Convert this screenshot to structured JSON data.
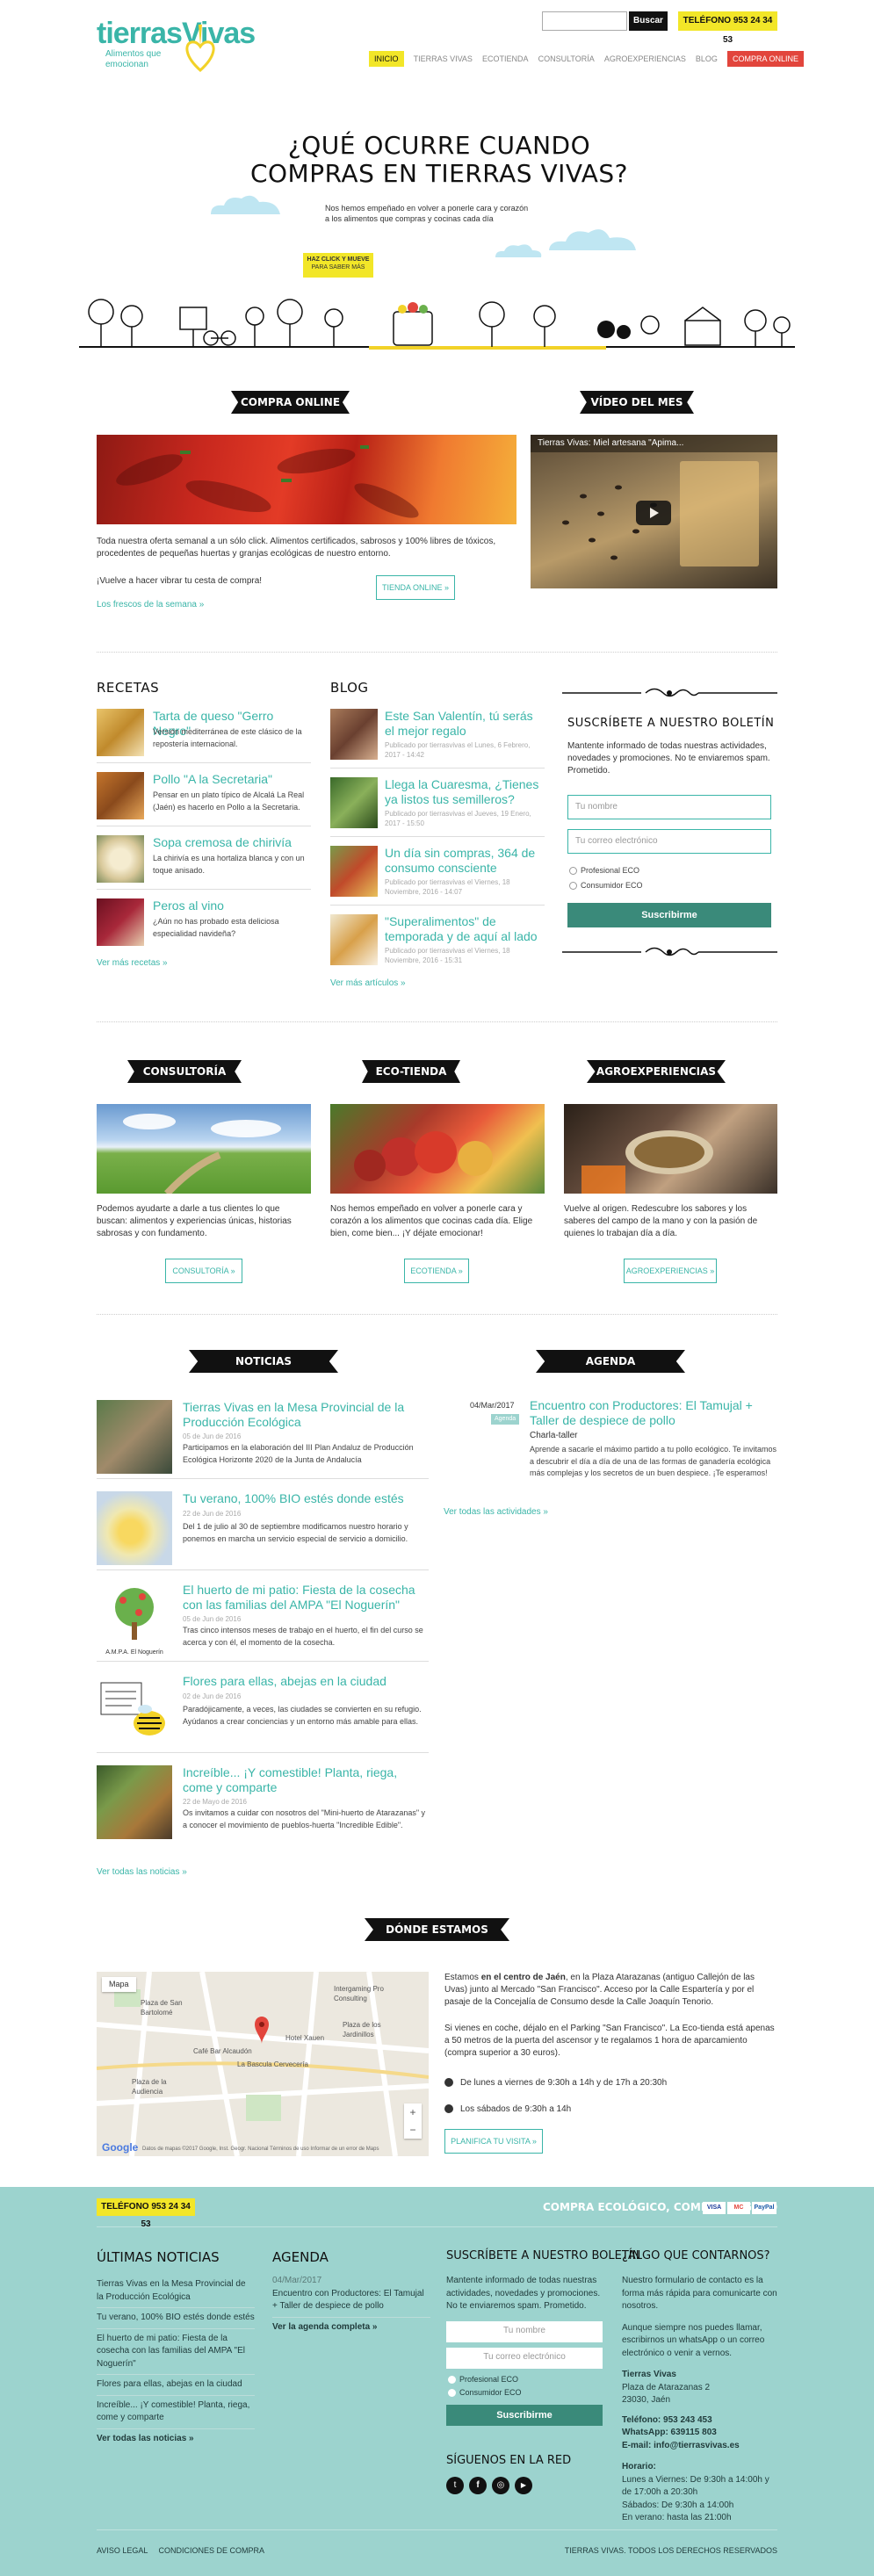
{
  "header": {
    "logo_title": "tierrasVivas",
    "logo_tagline": "Alimentos que emocionan",
    "search_button": "Buscar",
    "phone": "TELÉFONO 953 24 34 53",
    "nav": [
      "INICIO",
      "TIERRAS VIVAS",
      "ECOTIENDA",
      "CONSULTORÍA",
      "AGROEXPERIENCIAS",
      "BLOG",
      "COMPRA ONLINE"
    ]
  },
  "hero": {
    "title_line1": "¿QUÉ OCURRE CUANDO",
    "title_line2": "COMPRAS EN TIERRAS VIVAS?",
    "subtitle_line1": "Nos hemos empeñado en volver a ponerle cara y corazón",
    "subtitle_line2": "a los alimentos que compras y cocinas cada día",
    "badge_line1": "HAZ CLICK Y MUEVE",
    "badge_line2": "PARA SABER MÁS"
  },
  "compra_online": {
    "banner": "COMPRA ONLINE",
    "text": "Toda nuestra oferta semanal a un sólo click. Alimentos certificados, sabrosos y 100% libres de tóxicos, procedentes de pequeñas huertas y granjas ecológicas de nuestro entorno.",
    "cta_text": "¡Vuelve a hacer vibrar tu cesta de compra!",
    "button": "TIENDA ONLINE »",
    "link": "Los frescos de la semana »"
  },
  "video": {
    "banner": "VÍDEO DEL MES",
    "title": "Tierras Vivas: Miel artesana \"Apima..."
  },
  "recetas": {
    "heading": "RECETAS",
    "items": [
      {
        "title": "Tarta de queso \"Gerro Negro\"",
        "text": "Versión mediterránea de este clásico de la repostería internacional."
      },
      {
        "title": "Pollo \"A la Secretaria\"",
        "text": "Pensar en un plato típico de Alcalá La Real (Jaén) es hacerlo en Pollo a la Secretaria."
      },
      {
        "title": "Sopa cremosa de chirivía",
        "text": "La chirivía es una hortaliza blanca y con un toque anisado."
      },
      {
        "title": "Peros al vino",
        "text": "¿Aún no has probado esta deliciosa especialidad navideña?"
      }
    ],
    "more": "Ver más recetas »"
  },
  "blog": {
    "heading": "BLOG",
    "items": [
      {
        "title": "Este San Valentín, tú serás el mejor regalo",
        "meta": "Publicado por tierrasvivas el Lunes, 6 Febrero, 2017 - 14:42"
      },
      {
        "title": "Llega la Cuaresma, ¿Tienes ya listos tus semilleros?",
        "meta": "Publicado por tierrasvivas el Jueves, 19 Enero, 2017 - 15:50"
      },
      {
        "title": "Un día sin compras, 364 de consumo consciente",
        "meta": "Publicado por tierrasvivas el Viernes, 18 Noviembre, 2016 - 14:07"
      },
      {
        "title": "\"Superalimentos\" de temporada y de aquí al lado",
        "meta": "Publicado por tierrasvivas el Viernes, 18 Noviembre, 2016 - 15:31"
      }
    ],
    "more": "Ver más artículos »"
  },
  "newsletter": {
    "heading": "SUSCRÍBETE A NUESTRO BOLETÍN",
    "text": "Mantente informado de todas nuestras actividades, novedades y promociones. No te enviaremos spam. Prometido.",
    "name_placeholder": "Tu nombre",
    "email_placeholder": "Tu correo electrónico",
    "option1": "Profesional ECO",
    "option2": "Consumidor ECO",
    "button": "Suscribirme"
  },
  "services": [
    {
      "banner": "CONSULTORÍA",
      "text": "Podemos ayudarte a darle a tus clientes lo que buscan: alimentos y experiencias únicas, historias sabrosas y con fundamento.",
      "button": "CONSULTORÍA »"
    },
    {
      "banner": "ECO-TIENDA",
      "text": "Nos hemos empeñado en volver a ponerle cara y corazón a los alimentos que cocinas cada día. Elige bien, come bien... ¡Y déjate emocionar!",
      "button": "ECOTIENDA »"
    },
    {
      "banner": "AGROEXPERIENCIAS",
      "text": "Vuelve al origen. Redescubre los sabores y los saberes del campo de la mano y con la pasión de quienes lo trabajan día a día.",
      "button": "AGROEXPERIENCIAS »"
    }
  ],
  "noticias": {
    "banner": "NOTICIAS",
    "items": [
      {
        "title": "Tierras Vivas en la Mesa Provincial de la Producción Ecológica",
        "date": "05 de Jun de 2016",
        "text": "Participamos en la elaboración del III Plan Andaluz de Producción Ecológica Horizonte 2020 de la Junta de Andalucía"
      },
      {
        "title": "Tu verano, 100% BIO estés donde estés",
        "date": "22 de Jun de 2016",
        "text": "Del 1 de julio al 30 de septiembre modificamos nuestro horario y ponemos en marcha un servicio especial de servicio a domicilio."
      },
      {
        "title": "El huerto de mi patio: Fiesta de la cosecha con las familias del AMPA \"El Noguerín\"",
        "date": "05 de Jun de 2016",
        "text": "Tras cinco intensos meses de trabajo en el huerto, el fin del curso se acerca y con él, el momento de la cosecha."
      },
      {
        "title": "Flores para ellas, abejas en la ciudad",
        "date": "02 de Jun de 2016",
        "text": "Paradójicamente, a veces, las ciudades se convierten en su refugio. Ayúdanos a crear conciencias y un entorno más amable para ellas."
      },
      {
        "title": "Increíble... ¡Y comestible! Planta, riega, come y comparte",
        "date": "22 de Mayo de 2016",
        "text": "Os invitamos a cuidar con nosotros del \"Mini-huerto de Atarazanas\" y a conocer el movimiento de pueblos-huerta \"Incredible Edible\"."
      }
    ],
    "more": "Ver todas las noticias »",
    "img3_caption": "A.M.P.A. El Noguerín"
  },
  "agenda": {
    "banner": "AGENDA",
    "date": "04/Mar/2017",
    "tag": "Agenda",
    "title": "Encuentro con Productores: El Tamujal + Taller de despiece de pollo",
    "subtitle": "Charla-taller",
    "text": "Aprende a sacarle el máximo partido a tu pollo ecológico. Te invitamos a descubrir el día a día de una de las formas de ganadería ecológica más complejas y los secretos de un buen despiece. ¡Te esperamos!",
    "more": "Ver todas las actividades »"
  },
  "donde": {
    "banner": "DÓNDE ESTAMOS",
    "p1_a": "Estamos ",
    "p1_b": "en el centro de Jaén",
    "p1_c": ", en la Plaza Atarazanas (antiguo Callejón de las Uvas) junto al Mercado \"San Francisco\". Acceso por la Calle Espartería y por el pasaje de la Concejalía de Consumo desde la Calle Joaquín Tenorio.",
    "p2": "Si vienes en coche, déjalo en el Parking \"San Francisco\". La Eco-tienda está apenas a 50 metros de la puerta del ascensor y te regalamos 1 hora de aparcamiento (compra superior a 30 euros).",
    "h1": "De lunes a viernes de 9:30h a 14h y de 17h a 20:30h",
    "h2": "Los sábados de 9:30h a 14h",
    "button": "PLANIFICA TU VISITA »",
    "map": {
      "tab": "Mapa",
      "l1": "Plaza de San Bartolomé",
      "l2": "Intergaming Pro Consulting",
      "l3": "Plaza de los Jardinillos",
      "l4": "Café Bar Alcaudón",
      "l5": "Plaza de la Audiencia",
      "l6": "La Bascula Cervecería",
      "l7": "Hotel Xauen",
      "brand": "Google",
      "attr": "Datos de mapas ©2017 Google, Inst. Geogr. Nacional   Términos de uso   Informar de un error de Maps"
    }
  },
  "footer": {
    "phone": "TELÉFONO 953 24 34 53",
    "slogan": "COMPRA ECOLÓGICO, COMPRA SEGURO",
    "pay": [
      "VISA",
      "MC",
      "PayPal"
    ],
    "news_h": "ÚLTIMAS NOTICIAS",
    "news": [
      "Tierras Vivas en la Mesa Provincial de la Producción Ecológica",
      "Tu verano, 100% BIO estés donde estés",
      "El huerto de mi patio: Fiesta de la cosecha con las familias del AMPA \"El Noguerín\"",
      "Flores para ellas, abejas en la ciudad",
      "Increíble... ¡Y comestible! Planta, riega, come y comparte"
    ],
    "news_more": "Ver todas las noticias »",
    "agenda_h": "AGENDA",
    "agenda_date": "04/Mar/2017",
    "agenda_item": "Encuentro con Productores: El Tamujal + Taller de despiece de pollo",
    "agenda_more": "Ver la agenda completa »",
    "sub_h": "SUSCRÍBETE A NUESTRO BOLETÍN",
    "sub_text": "Mantente informado de todas nuestras actividades, novedades y promociones. No te enviaremos spam. Prometido.",
    "sub_name": "Tu nombre",
    "sub_email": "Tu correo electrónico",
    "sub_opt1": "Profesional ECO",
    "sub_opt2": "Consumidor ECO",
    "sub_btn": "Suscribirme",
    "follow_h": "SÍGUENOS EN LA RED",
    "contact_h": "¿ALGO QUE CONTARNOS?",
    "contact_p1": "Nuestro formulario de contacto es la forma más rápida para comunicarte con nosotros.",
    "contact_p2": "Aunque siempre nos puedes llamar, escribirnos un whatsApp o un correo electrónico o venir a vernos.",
    "company": "Tierras Vivas",
    "addr1": "Plaza de Atarazanas 2",
    "addr2": "23030, Jaén",
    "tel": "Teléfono: 953 243 453",
    "whatsapp": "WhatsApp: 639115 803",
    "email": "E-mail: info@tierrasvivas.es",
    "hours_h": "Horario:",
    "hours1": "Lunes a Viernes: De 9:30h a 14:00h y de 17:00h a 20:30h",
    "hours2": "Sábados: De 9:30h a 14:00h",
    "hours3": "En verano: hasta las 21:00h",
    "legal1": "AVISO LEGAL",
    "legal2": "CONDICIONES DE COMPRA",
    "rights": "TIERRAS VIVAS. TODOS LOS DERECHOS RESERVADOS"
  },
  "colors": {
    "accent": "#3ab5a8",
    "footer_bg": "#9cd3ce",
    "yellow": "#f2e628",
    "red_nav": "#e2453c"
  }
}
